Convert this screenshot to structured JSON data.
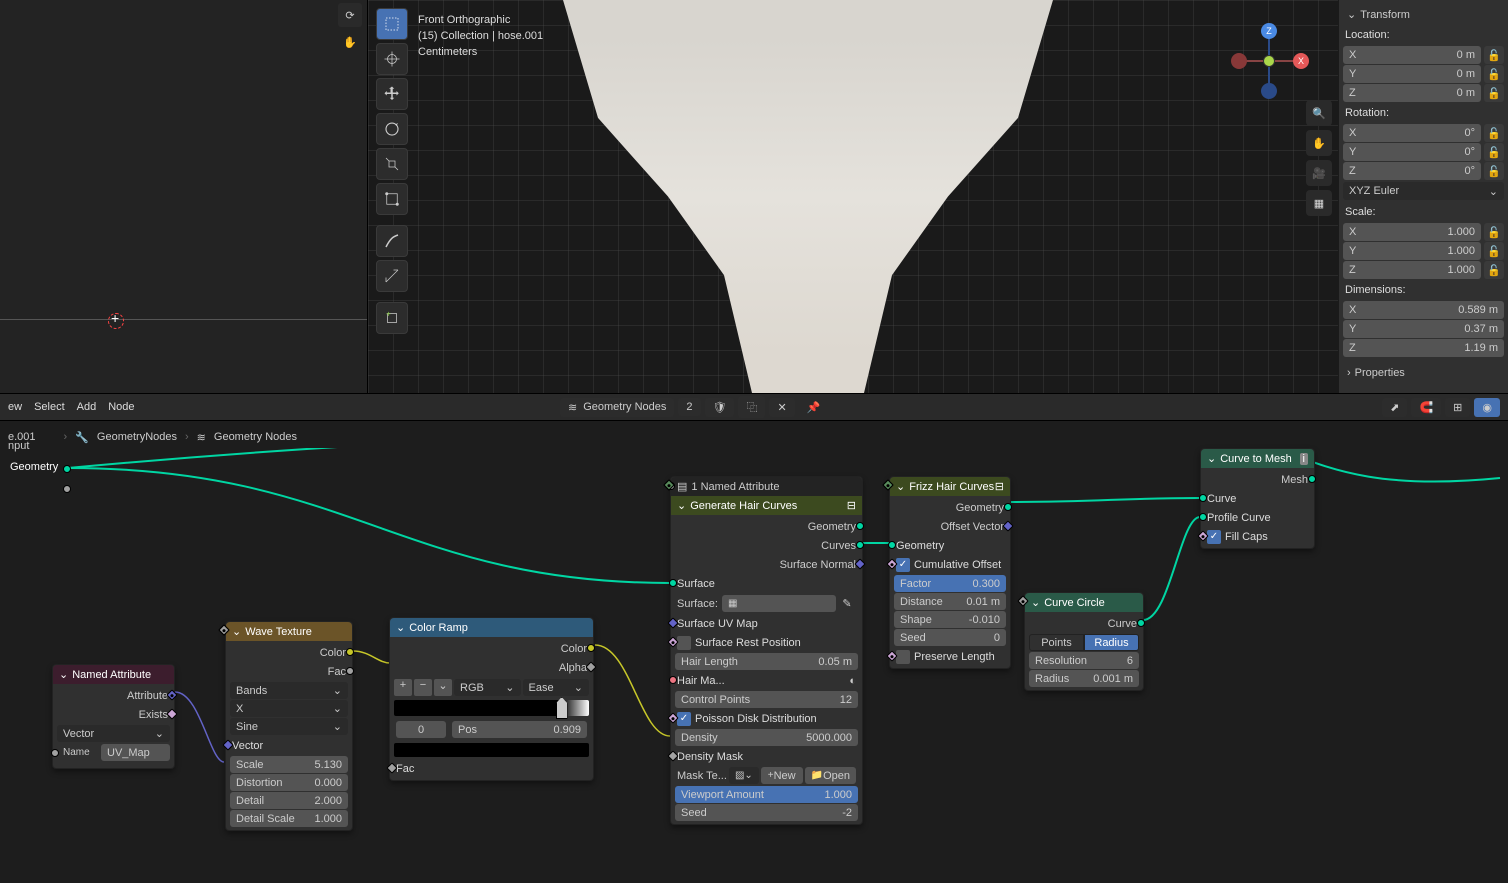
{
  "viewport": {
    "projection": "Front Orthographic",
    "context": "(15) Collection | hose.001",
    "units": "Centimeters"
  },
  "transform": {
    "header": "Transform",
    "location_label": "Location:",
    "rotation_label": "Rotation:",
    "scale_label": "Scale:",
    "dimensions_label": "Dimensions:",
    "rotation_mode": "XYZ Euler",
    "location": {
      "x": "0 m",
      "y": "0 m",
      "z": "0 m"
    },
    "rotation": {
      "x": "0°",
      "y": "0°",
      "z": "0°"
    },
    "scale": {
      "x": "1.000",
      "y": "1.000",
      "z": "1.000"
    },
    "dimensions": {
      "x": "0.589 m",
      "y": "0.37 m",
      "z": "1.19 m"
    },
    "properties_label": "Properties"
  },
  "node_editor": {
    "menus": [
      "ew",
      "Select",
      "Add",
      "Node"
    ],
    "tree_name": "Geometry Nodes",
    "tree_users": "2",
    "breadcrumb": {
      "obj": "e.001",
      "sub": "nput",
      "mod": "GeometryNodes",
      "tree": "Geometry Nodes"
    },
    "group_input_socket": "Geometry"
  },
  "nodes": {
    "named_attr": {
      "title": "Named Attribute",
      "out_attribute": "Attribute",
      "out_exists": "Exists",
      "type_dd": "Vector",
      "name_label": "Name",
      "name_value": "UV_Map"
    },
    "wave": {
      "title": "Wave Texture",
      "out_color": "Color",
      "out_fac": "Fac",
      "type": "Bands",
      "direction": "X",
      "profile": "Sine",
      "in_vector": "Vector",
      "scale_label": "Scale",
      "scale_val": "5.130",
      "distortion_label": "Distortion",
      "distortion_val": "0.000",
      "detail_label": "Detail",
      "detail_val": "2.000",
      "detail_scale_label": "Detail Scale",
      "detail_scale_val": "1.000"
    },
    "ramp": {
      "title": "Color Ramp",
      "out_color": "Color",
      "out_alpha": "Alpha",
      "interp": "RGB",
      "ease": "Ease",
      "stop_index": "0",
      "pos_label": "Pos",
      "pos_val": "0.909",
      "in_fac": "Fac"
    },
    "gen_hair": {
      "named_header": "1 Named Attribute",
      "title": "Generate Hair Curves",
      "out_geometry": "Geometry",
      "out_curves": "Curves",
      "out_normal": "Surface Normal",
      "surface": "Surface",
      "surface_obj": "Surface:",
      "uvmap": "Surface UV Map",
      "restpos": "Surface Rest Position",
      "hair_len_label": "Hair Length",
      "hair_len_val": "0.05 m",
      "hair_mat": "Hair Ma...",
      "ctrl_label": "Control Points",
      "ctrl_val": "12",
      "poisson": "Poisson Disk Distribution",
      "density_label": "Density",
      "density_val": "5000.000",
      "density_mask": "Density Mask",
      "mask_tex": "Mask Te...",
      "new_btn": "New",
      "open_btn": "Open",
      "viewport_amt_label": "Viewport Amount",
      "viewport_amt_val": "1.000",
      "seed_label": "Seed",
      "seed_val": "-2"
    },
    "frizz": {
      "title": "Frizz Hair Curves",
      "out_geometry": "Geometry",
      "out_offset": "Offset Vector",
      "in_geometry": "Geometry",
      "cumulative": "Cumulative Offset",
      "factor_label": "Factor",
      "factor_val": "0.300",
      "distance_label": "Distance",
      "distance_val": "0.01 m",
      "shape_label": "Shape",
      "shape_val": "-0.010",
      "seed_label": "Seed",
      "seed_val": "0",
      "preserve": "Preserve Length"
    },
    "circle": {
      "title": "Curve Circle",
      "out_curve": "Curve",
      "mode_points": "Points",
      "mode_radius": "Radius",
      "res_label": "Resolution",
      "res_val": "6",
      "rad_label": "Radius",
      "rad_val": "0.001 m"
    },
    "c2m": {
      "title": "Curve to Mesh",
      "out_mesh": "Mesh",
      "in_curve": "Curve",
      "in_profile": "Profile Curve",
      "fill_caps": "Fill Caps"
    }
  }
}
